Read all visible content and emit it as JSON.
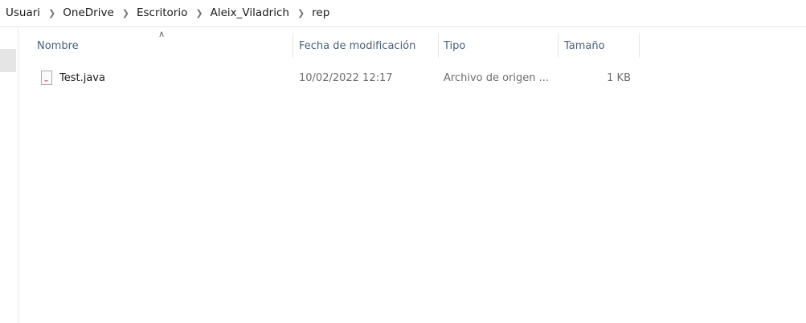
{
  "breadcrumb": [
    "Usuari",
    "OneDrive",
    "Escritorio",
    "Aleix_Viladrich",
    "rep"
  ],
  "breadcrumb_separator_icon": "chevron-right-icon",
  "columns": {
    "name": "Nombre",
    "modified": "Fecha de modificación",
    "type": "Tipo",
    "size": "Tamaño"
  },
  "sort_indicator_icon": "chevron-up-icon",
  "files": [
    {
      "name": "Test.java",
      "modified": "10/02/2022 12:17",
      "type": "Archivo de origen ...",
      "size": "1 KB",
      "icon": "java-file-icon"
    }
  ]
}
